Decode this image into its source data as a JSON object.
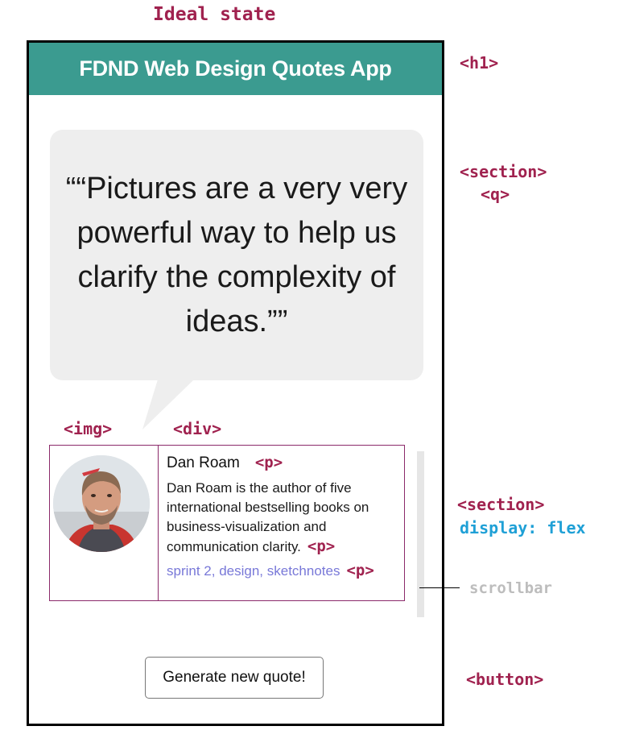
{
  "title_annotation": "Ideal state",
  "app": {
    "header_title": "FDND Web Design Quotes App",
    "quote": "“Pictures are a very very powerful way to help us clarify the complexity of ideas.”",
    "author": {
      "name": "Dan Roam",
      "bio": "Dan Roam is the author of five international bestselling books on business-visualization and communication clarity.",
      "tags": "sprint 2, design, sketchnotes"
    },
    "button_label": "Generate new quote!"
  },
  "annotations": {
    "h1": "<h1>",
    "section": "<section>",
    "q": "<q>",
    "img": "<img>",
    "div": "<div>",
    "p_name": "<p>",
    "p_bio": "<p>",
    "p_tags": "<p>",
    "section_flex": "<section>",
    "display_flex": "display: flex",
    "scrollbar": "scrollbar",
    "button": "<button>"
  },
  "colors": {
    "header_bg": "#3b9b90",
    "annotation_tag": "#a0224f",
    "annotation_css": "#1fa0d6",
    "tags_text": "#7878d8",
    "card_border": "#8b2a6a"
  }
}
